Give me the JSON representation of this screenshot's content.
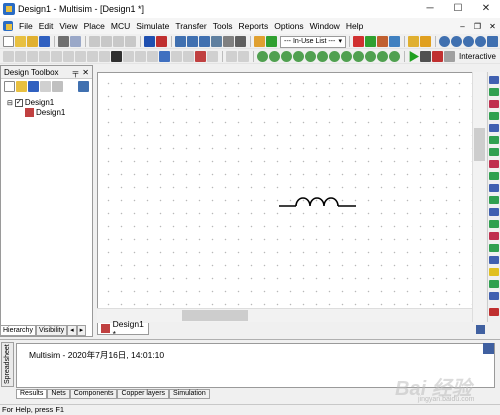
{
  "window": {
    "title": "Design1 - Multisim - [Design1 *]",
    "minimize": "─",
    "maximize": "☐",
    "close": "✕"
  },
  "menu": [
    "File",
    "Edit",
    "View",
    "Place",
    "MCU",
    "Simulate",
    "Transfer",
    "Tools",
    "Reports",
    "Options",
    "Window",
    "Help"
  ],
  "mdi_controls": [
    "‒",
    "❐",
    "✕"
  ],
  "toolbar": {
    "in_use_list": "--- In-Use List ---",
    "interactive_label": "Interactive"
  },
  "design_toolbox": {
    "title": "Design Toolbox",
    "pin": "╤",
    "close": "✕",
    "tree_root": "Design1",
    "tree_child": "Design1",
    "tabs": [
      "Hierarchy",
      "Visibility"
    ]
  },
  "doc_tab": "Design1 *",
  "spreadsheet_label": "Spreadsheet",
  "log": {
    "line": "Multisim  -  2020年7月16日, 14:01:10"
  },
  "bottom_tabs": [
    "Results",
    "Nets",
    "Components",
    "Copper layers",
    "Simulation"
  ],
  "status_text": "For Help, press F1",
  "watermark": {
    "text": "Bai 经验",
    "sub": "jingyan.baidu.com"
  },
  "colors": {
    "accent_blue": "#2a6cc4",
    "run_green": "#20a020",
    "canvas_bg": "#ffffff",
    "grid_dot": "#b8b8b8"
  }
}
